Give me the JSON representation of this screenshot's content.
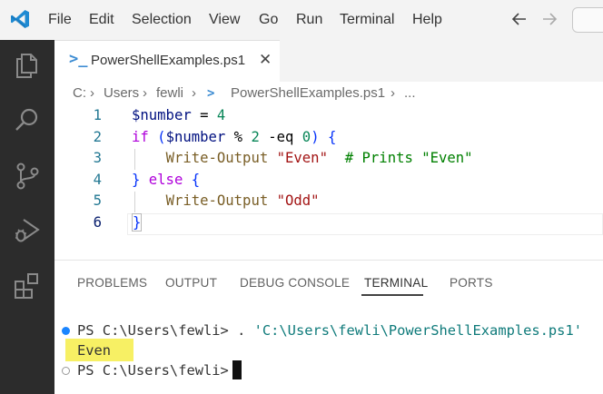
{
  "menu": {
    "items": [
      "File",
      "Edit",
      "Selection",
      "View",
      "Go",
      "Run",
      "Terminal",
      "Help"
    ]
  },
  "icons": {
    "logo": "vscode-logo-icon",
    "back": "arrow-left-icon",
    "forward": "arrow-right-icon",
    "activity": [
      "explorer-icon",
      "search-icon",
      "source-control-icon",
      "run-debug-icon",
      "extensions-icon"
    ]
  },
  "colors": {
    "accent": "#007acc",
    "activity_bar": "#2c2c2c",
    "highlight": "#f7f064"
  },
  "tab": {
    "icon_glyph": ">_",
    "label": "PowerShellExamples.ps1",
    "close": "✕"
  },
  "breadcrumb": [
    "C:",
    "Users",
    "fewli",
    "PowerShellExamples.ps1",
    "..."
  ],
  "editor": {
    "line_numbers": [
      "1",
      "2",
      "3",
      "4",
      "5",
      "6"
    ],
    "lines": [
      "$number = 4",
      "if ($number % 2 -eq 0) {",
      "    Write-Output \"Even\"  # Prints \"Even\"",
      "} else {",
      "    Write-Output \"Odd\"",
      "}"
    ]
  },
  "panel": {
    "tabs": [
      "PROBLEMS",
      "OUTPUT",
      "DEBUG CONSOLE",
      "TERMINAL",
      "PORTS"
    ],
    "active_tab": "TERMINAL"
  },
  "terminal": {
    "prompt": "PS C:\\Users\\fewli> ",
    "command_dot": ". ",
    "command_path": "'C:\\Users\\fewli\\PowerShellExamples.ps1'",
    "output": "Even",
    "prompt2": "PS C:\\Users\\fewli> "
  }
}
